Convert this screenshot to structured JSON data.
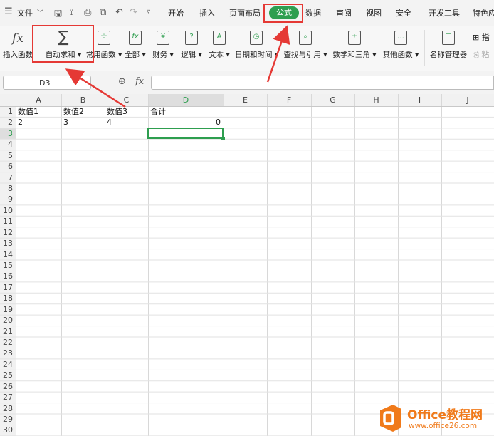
{
  "menubar": {
    "file": "文件",
    "tabs": [
      "开始",
      "插入",
      "页面布局",
      "公式",
      "数据",
      "审阅",
      "视图",
      "安全",
      "开发工具",
      "特色应"
    ],
    "active_tab": "公式"
  },
  "ribbon": {
    "buttons": [
      {
        "label": "插入函数"
      },
      {
        "label": "自动求和"
      },
      {
        "label": "常用函数"
      },
      {
        "label": "全部"
      },
      {
        "label": "财务"
      },
      {
        "label": "逻辑"
      },
      {
        "label": "文本"
      },
      {
        "label": "日期和时间"
      },
      {
        "label": "查找与引用"
      },
      {
        "label": "数学和三角"
      },
      {
        "label": "其他函数"
      },
      {
        "label": "名称管理器"
      }
    ],
    "right_top": "指",
    "right_bottom": "粘"
  },
  "formula_bar": {
    "cell_ref": "D3",
    "fx": "fx",
    "value": ""
  },
  "sheet": {
    "columns": [
      "A",
      "B",
      "C",
      "D",
      "E",
      "F",
      "G",
      "H",
      "I",
      "J"
    ],
    "rows": [
      "1",
      "2",
      "3",
      "4",
      "5",
      "6",
      "7",
      "8",
      "9",
      "10",
      "11",
      "12",
      "13",
      "14",
      "15",
      "16",
      "17",
      "18",
      "19",
      "20",
      "21",
      "22",
      "23",
      "24",
      "25",
      "26",
      "27",
      "28",
      "29",
      "30"
    ],
    "cells": {
      "A1": "数值1",
      "B1": "数值2",
      "C1": "数值3",
      "D1": "合计",
      "A2": "2",
      "B2": "3",
      "C2": "4",
      "D2": "0"
    },
    "selected": "D3"
  },
  "watermark": {
    "brand": "Office教程网",
    "url": "www.office26.com"
  },
  "colors": {
    "accent": "#2e9e4f",
    "highlight": "#e53935",
    "brand": "#f07a1a"
  }
}
